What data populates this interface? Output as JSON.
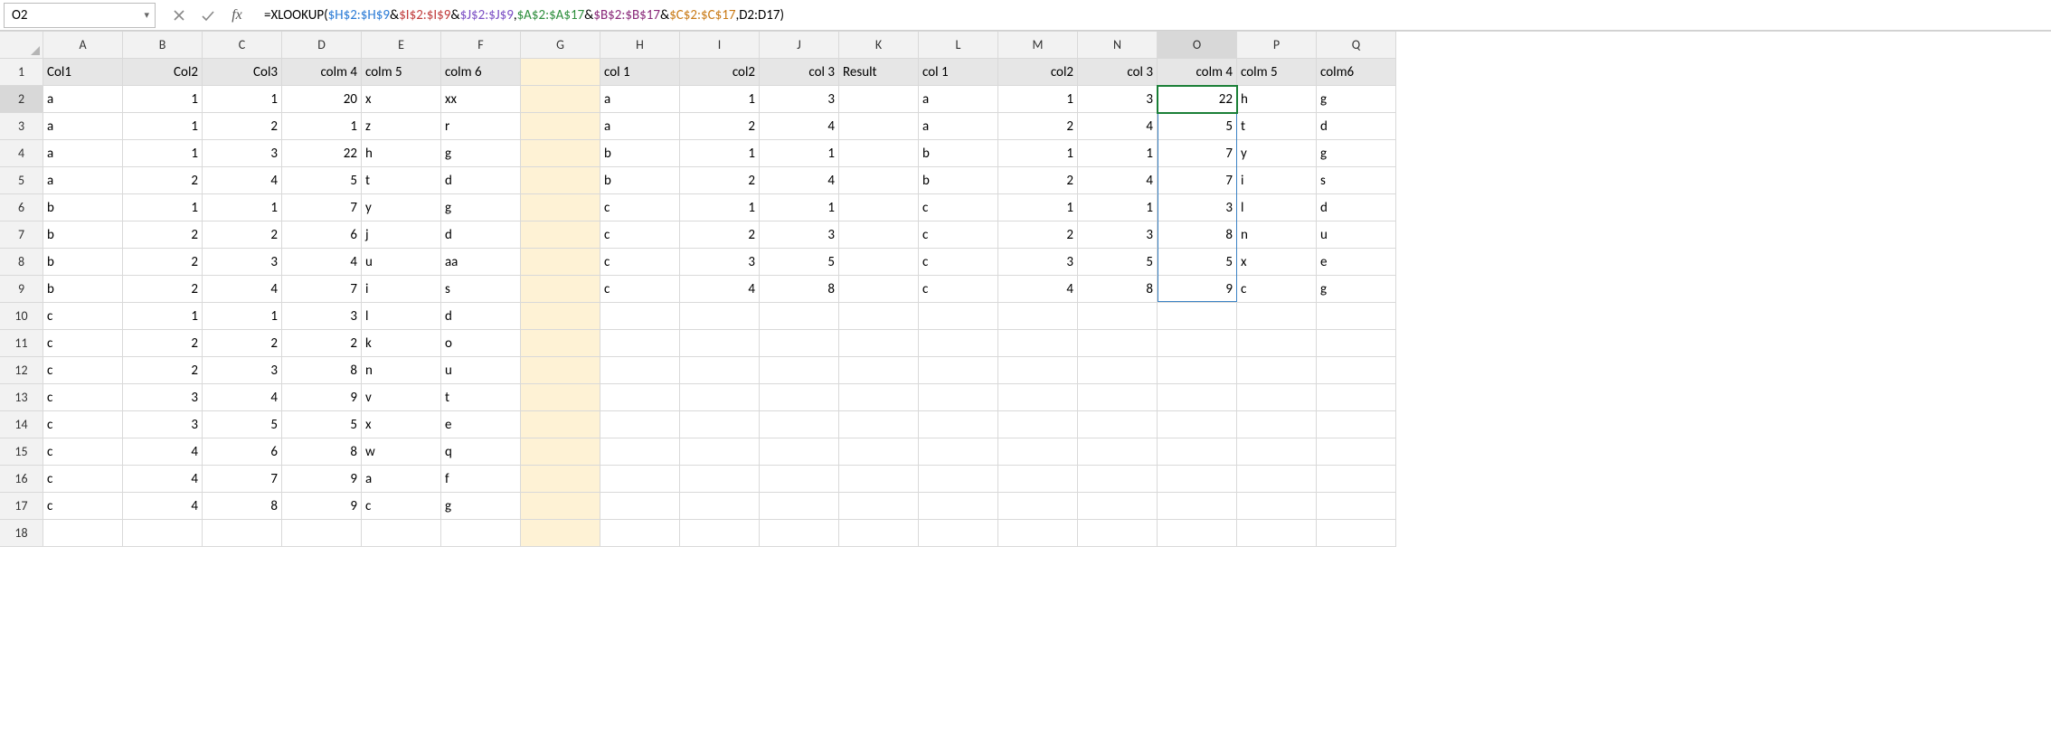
{
  "nameBox": {
    "value": "O2"
  },
  "formula": {
    "eq": "=",
    "fn": "XLOOKUP",
    "open": "(",
    "close": ")",
    "amp": "&",
    "comma": ",",
    "r1": "$H$2:$H$9",
    "r2": "$I$2:$I$9",
    "r3": "$J$2:$J$9",
    "r4": "$A$2:$A$17",
    "r5": "$B$2:$B$17",
    "r6": "$C$2:$C$17",
    "r7": "D2:D17"
  },
  "columns": [
    "A",
    "B",
    "C",
    "D",
    "E",
    "F",
    "G",
    "H",
    "I",
    "J",
    "K",
    "L",
    "M",
    "N",
    "O",
    "P",
    "Q"
  ],
  "rowCount": 18,
  "activeCell": "O2",
  "activeCol": "O",
  "activeRow": 2,
  "spill": {
    "col": "O",
    "startRow": 2,
    "endRow": 9
  },
  "headersRow1": {
    "A": "Col1",
    "B": "Col2",
    "C": "Col3",
    "D": "colm 4",
    "E": "colm 5",
    "F": "colm 6",
    "H": "col 1",
    "I": "col2",
    "J": "col 3",
    "K": "Result",
    "L": "col 1",
    "M": "col2",
    "N": "col 3",
    "O": "colm 4",
    "P": "colm 5",
    "Q": "colm6"
  },
  "cells": {
    "2": {
      "A": "a",
      "B": 1,
      "C": 1,
      "D": 20,
      "E": "x",
      "F": "xx",
      "H": "a",
      "I": 1,
      "J": 3,
      "L": "a",
      "M": 1,
      "N": 3,
      "O": 22,
      "P": "h",
      "Q": "g"
    },
    "3": {
      "A": "a",
      "B": 1,
      "C": 2,
      "D": 1,
      "E": "z",
      "F": "r",
      "H": "a",
      "I": 2,
      "J": 4,
      "L": "a",
      "M": 2,
      "N": 4,
      "O": 5,
      "P": "t",
      "Q": "d"
    },
    "4": {
      "A": "a",
      "B": 1,
      "C": 3,
      "D": 22,
      "E": "h",
      "F": "g",
      "H": "b",
      "I": 1,
      "J": 1,
      "L": "b",
      "M": 1,
      "N": 1,
      "O": 7,
      "P": "y",
      "Q": "g"
    },
    "5": {
      "A": "a",
      "B": 2,
      "C": 4,
      "D": 5,
      "E": "t",
      "F": "d",
      "H": "b",
      "I": 2,
      "J": 4,
      "L": "b",
      "M": 2,
      "N": 4,
      "O": 7,
      "P": "i",
      "Q": "s"
    },
    "6": {
      "A": "b",
      "B": 1,
      "C": 1,
      "D": 7,
      "E": "y",
      "F": "g",
      "H": "c",
      "I": 1,
      "J": 1,
      "L": "c",
      "M": 1,
      "N": 1,
      "O": 3,
      "P": "l",
      "Q": "d"
    },
    "7": {
      "A": "b",
      "B": 2,
      "C": 2,
      "D": 6,
      "E": "j",
      "F": "d",
      "H": "c",
      "I": 2,
      "J": 3,
      "L": "c",
      "M": 2,
      "N": 3,
      "O": 8,
      "P": "n",
      "Q": "u"
    },
    "8": {
      "A": "b",
      "B": 2,
      "C": 3,
      "D": 4,
      "E": "u",
      "F": "aa",
      "H": "c",
      "I": 3,
      "J": 5,
      "L": "c",
      "M": 3,
      "N": 5,
      "O": 5,
      "P": "x",
      "Q": "e"
    },
    "9": {
      "A": "b",
      "B": 2,
      "C": 4,
      "D": 7,
      "E": "i",
      "F": "s",
      "H": "c",
      "I": 4,
      "J": 8,
      "L": "c",
      "M": 4,
      "N": 8,
      "O": 9,
      "P": "c",
      "Q": "g"
    },
    "10": {
      "A": "c",
      "B": 1,
      "C": 1,
      "D": 3,
      "E": "l",
      "F": "d"
    },
    "11": {
      "A": "c",
      "B": 2,
      "C": 2,
      "D": 2,
      "E": "k",
      "F": "o"
    },
    "12": {
      "A": "c",
      "B": 2,
      "C": 3,
      "D": 8,
      "E": "n",
      "F": "u"
    },
    "13": {
      "A": "c",
      "B": 3,
      "C": 4,
      "D": 9,
      "E": "v",
      "F": "t"
    },
    "14": {
      "A": "c",
      "B": 3,
      "C": 5,
      "D": 5,
      "E": "x",
      "F": "e"
    },
    "15": {
      "A": "c",
      "B": 4,
      "C": 6,
      "D": 8,
      "E": "w",
      "F": "q"
    },
    "16": {
      "A": "c",
      "B": 4,
      "C": 7,
      "D": 9,
      "E": "a",
      "F": "f"
    },
    "17": {
      "A": "c",
      "B": 4,
      "C": 8,
      "D": 9,
      "E": "c",
      "F": "g"
    }
  },
  "numericCols": [
    "B",
    "C",
    "D",
    "I",
    "J",
    "M",
    "N",
    "O"
  ]
}
